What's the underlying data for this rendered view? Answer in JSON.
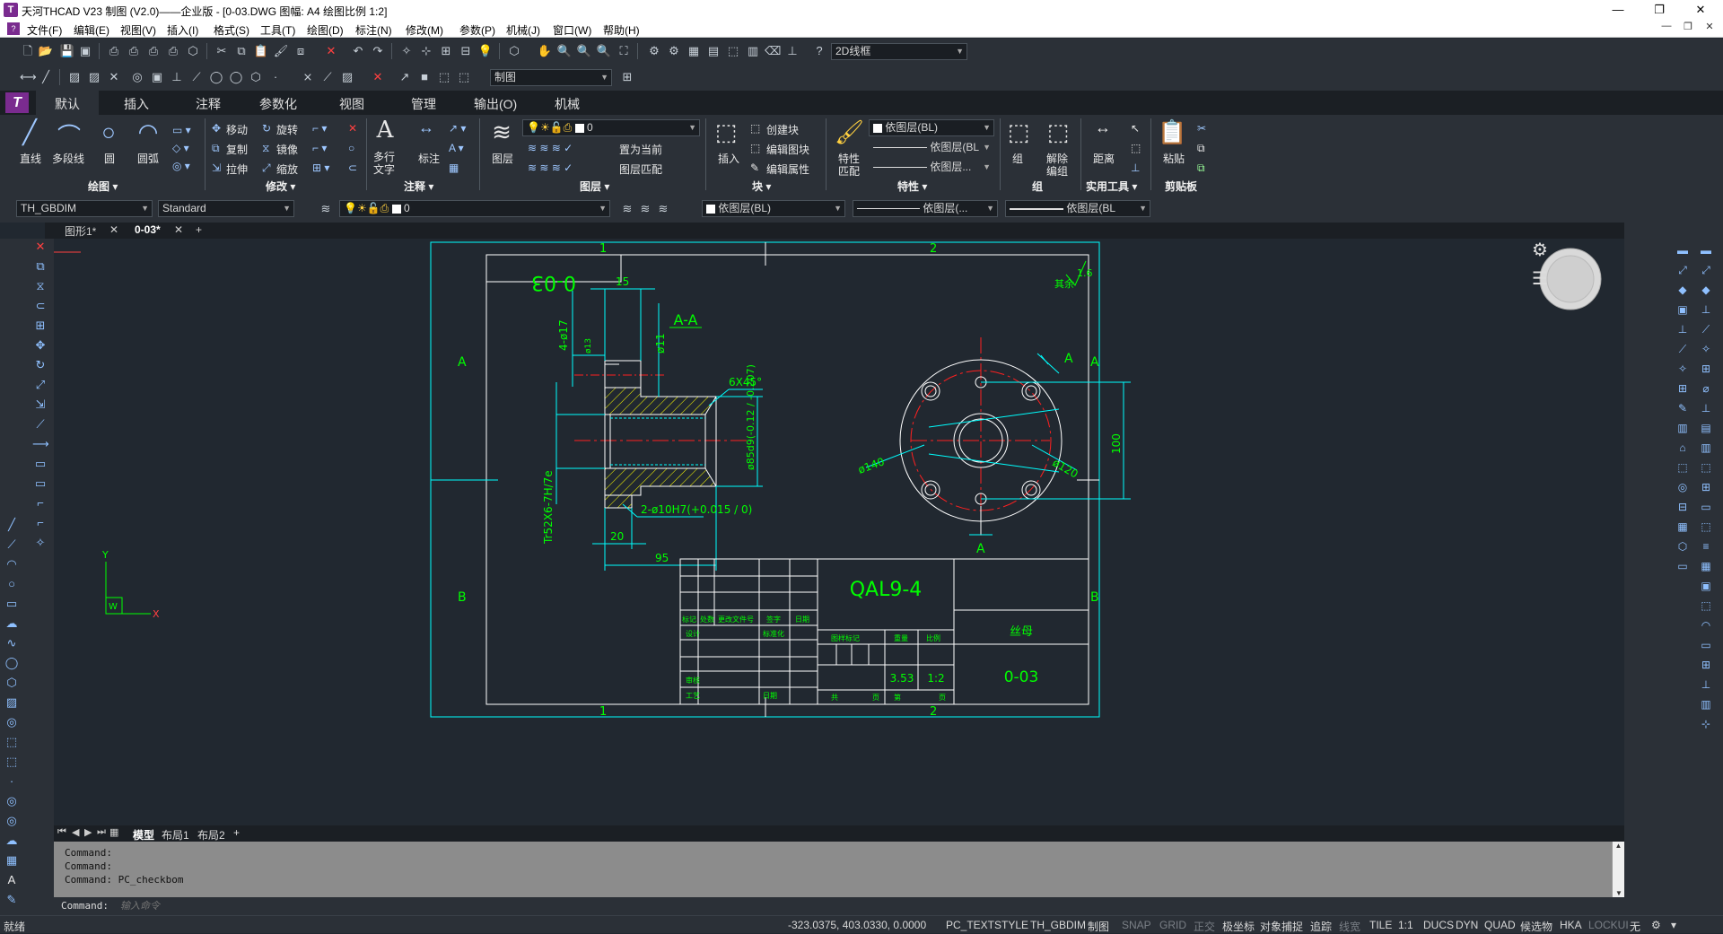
{
  "titlebar": {
    "title": "天河THCAD V23 制图 (V2.0)——企业版 - [0-03.DWG 图幅: A4 绘图比例 1:2]",
    "minimize": "—",
    "restore": "❐",
    "close": "✕"
  },
  "menu": [
    "文件(F)",
    "编辑(E)",
    "视图(V)",
    "插入(I)",
    "格式(S)",
    "工具(T)",
    "绘图(D)",
    "标注(N)",
    "修改(M)",
    "参数(P)",
    "机械(J)",
    "窗口(W)",
    "帮助(H)"
  ],
  "toolbar1": {
    "visual_style": "2D线框"
  },
  "toolbar2": {
    "workspace": "制图"
  },
  "ribbon": {
    "tabs": [
      "默认",
      "插入",
      "注释",
      "参数化",
      "视图",
      "管理",
      "输出(O)",
      "机械"
    ],
    "draw": {
      "line": "直线",
      "polyline": "多段线",
      "circle": "圆",
      "arc": "圆弧",
      "group": "绘图 ▾"
    },
    "modify": {
      "move": "移动",
      "rotate": "旋转",
      "copy": "复制",
      "mirror": "镜像",
      "stretch": "拉伸",
      "scale": "缩放",
      "group": "修改 ▾"
    },
    "annotation": {
      "mtext_line1": "多行",
      "mtext_line2": "文字",
      "dimension": "标注",
      "group": "注释 ▾"
    },
    "layers": {
      "layer": "图层",
      "layer_value": "0",
      "set_current": "置为当前",
      "match": "图层匹配",
      "group": "图层 ▾"
    },
    "block": {
      "insert": "插入",
      "create": "创建块",
      "edit": "编辑图块",
      "attr": "编辑属性",
      "group": "块 ▾"
    },
    "properties": {
      "match_line1": "特性",
      "match_line2": "匹配",
      "color": "依图层(BL)",
      "linetype": "依图层(BL",
      "lineweight": "依图层...",
      "group": "特性 ▾"
    },
    "groups": {
      "group": "组",
      "ungroup_line1": "解除",
      "ungroup_line2": "编组",
      "label": "组"
    },
    "utilities": {
      "distance": "距离",
      "group": "实用工具 ▾"
    },
    "clipboard": {
      "paste": "粘贴",
      "group": "剪贴板"
    }
  },
  "proprow": {
    "dimstyle": "TH_GBDIM",
    "textstyle": "Standard",
    "layer": "0",
    "color": "依图层(BL)",
    "linetype": "依图层(...",
    "lineweight": "依图层(BL"
  },
  "doctabs": {
    "tab1": "图形1*",
    "tab2": "0-03*",
    "add": "+"
  },
  "drawing": {
    "zone_top_1": "1",
    "zone_top_2": "2",
    "zone_bottom_1": "1",
    "zone_bottom_2": "2",
    "zone_left_a": "A",
    "zone_left_b": "B",
    "zone_right_a": "A",
    "zone_right_b": "B",
    "code_box": "0-03",
    "roughness_text": "其余",
    "roughness_value": "1.6",
    "section_title": "A-A",
    "dim_15": "15",
    "dim_4phi17": "4-ø17",
    "dim_phi11": "ø11",
    "dim_phi13": "ø13",
    "dim_chamfer": "6X45°",
    "dim_phi85": "ø85d9(-0.12 / -0.207)",
    "dim_thread": "Tr52X6-7H/7e",
    "dim_2phi10": "2-ø10H7(+0.015 / 0)",
    "dim_20": "20",
    "dim_95": "95",
    "dim_phi140": "ø140",
    "dim_phi120": "ø120",
    "dim_100": "100",
    "arrow_a1": "A",
    "arrow_a2": "A",
    "tb_part": "QAL9-4",
    "tb_material": "丝母",
    "tb_number": "0-03",
    "tb_weight": "3.53",
    "tb_scale": "1:2",
    "tb_h_mark": "标记",
    "tb_h_count": "处数",
    "tb_h_file": "更改文件号",
    "tb_h_sign": "签字",
    "tb_h_date": "日期",
    "tb_design": "设计",
    "tb_std": "标准化",
    "tb_check": "审核",
    "tb_craft": "工艺",
    "tb_date2": "日期",
    "tb_stage": "图样标记",
    "tb_weight_h": "重量",
    "tb_scale_h": "比例",
    "tb_total": "共",
    "tb_page": "页",
    "tb_sheet": "第",
    "tb_page2": "页"
  },
  "ucs": {
    "x": "X",
    "y": "Y",
    "w": "W"
  },
  "layouttabs": {
    "model": "模型",
    "layout1": "布局1",
    "layout2": "布局2",
    "add": "+"
  },
  "command": {
    "line1": "Command:",
    "line2": "Command:",
    "line3": "Command: PC_checkbom",
    "prompt": "Command:",
    "placeholder": "输入命令"
  },
  "status": {
    "ready": "就绪",
    "coords": "-323.0375, 403.0330, 0.0000",
    "textstyle": "PC_TEXTSTYLE",
    "dimstyle": "TH_GBDIM",
    "mode": "制图",
    "snap": "SNAP",
    "grid": "GRID",
    "ortho": "正交",
    "polar": "极坐标",
    "osnap": "对象捕捉",
    "otrack": "追踪",
    "lwt": "线宽",
    "tile": "TILE",
    "scale": "1:1",
    "ducs": "DUCS",
    "dyn": "DYN",
    "quad": "QUAD",
    "sel": "候选物",
    "hka": "HKA",
    "lockui": "LOCKUI",
    "none": "无"
  },
  "colors": {
    "green": "#00ff00",
    "cyan": "#00ffff",
    "yellow": "#ffff00",
    "red": "#ff2020",
    "white": "#ffffff",
    "bg": "#212830"
  }
}
